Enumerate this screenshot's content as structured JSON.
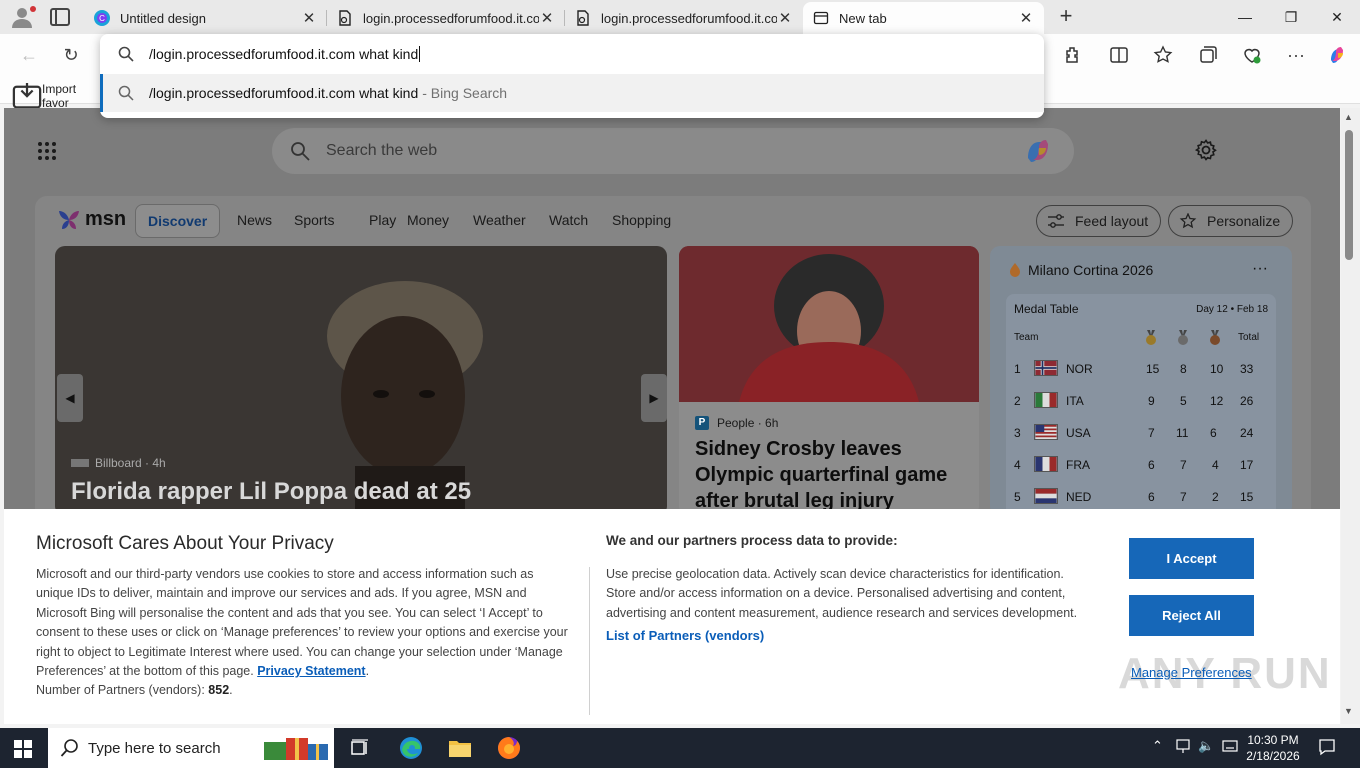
{
  "browser": {
    "tabs": [
      {
        "title": "Untitled design",
        "favicon": "canva-icon"
      },
      {
        "title": "login.processedforumfood.it.com",
        "favicon": "document-icon"
      },
      {
        "title": "login.processedforumfood.it.com",
        "favicon": "document-icon"
      },
      {
        "title": "New tab",
        "favicon": "newtab-icon"
      }
    ],
    "favorites_bar": {
      "import_label": "Import favor"
    }
  },
  "omnibox": {
    "typed": "/login.processedforumfood.it.com what kind",
    "suggestion_query": "/login.processedforumfood.it.com what kind",
    "suggestion_suffix": "- Bing Search"
  },
  "newtab": {
    "search_placeholder": "Search the web",
    "msn_logo": "msn",
    "nav": {
      "active": "Discover",
      "items": [
        "News",
        "Sports",
        "Play",
        "Money",
        "Weather",
        "Watch",
        "Shopping"
      ]
    },
    "feed_layout": "Feed layout",
    "personalize": "Personalize",
    "hero": {
      "source": "Billboard · 4h",
      "title": "Florida rapper Lil Poppa dead at 25"
    },
    "card2": {
      "source": "People · 6h",
      "badge": "P",
      "title": "Sidney Crosby leaves Olympic quarterfinal game after brutal leg injury"
    },
    "medal_widget": {
      "title": "Milano Cortina 2026",
      "table_title": "Medal Table",
      "day": "Day 12 • Feb 18",
      "col_team": "Team",
      "col_total": "Total",
      "rows": [
        {
          "rank": "1",
          "team": "NOR",
          "gold": "15",
          "silver": "8",
          "bronze": "10",
          "total": "33"
        },
        {
          "rank": "2",
          "team": "ITA",
          "gold": "9",
          "silver": "5",
          "bronze": "12",
          "total": "26"
        },
        {
          "rank": "3",
          "team": "USA",
          "gold": "7",
          "silver": "11",
          "bronze": "6",
          "total": "24"
        },
        {
          "rank": "4",
          "team": "FRA",
          "gold": "6",
          "silver": "7",
          "bronze": "4",
          "total": "17"
        },
        {
          "rank": "5",
          "team": "NED",
          "gold": "6",
          "silver": "7",
          "bronze": "2",
          "total": "15"
        }
      ]
    }
  },
  "privacy": {
    "title": "Microsoft Cares About Your Privacy",
    "body": "Microsoft and our third-party vendors use cookies to store and access information such as unique IDs to deliver, maintain and improve our services and ads. If you agree, MSN and Microsoft Bing will personalise the content and ads that you see. You can select ‘I Accept’ to consent to these uses or click on ‘Manage preferences’ to review your options and exercise your right to object to Legitimate Interest where used.  You can change your selection under ‘Manage Preferences’ at the bottom of this page.",
    "privacy_link": "Privacy Statement",
    "partners_count_label": "Number of Partners (vendors):",
    "partners_count": "852",
    "data_heading": "We and our partners process data to provide:",
    "data_body": "Use precise geolocation data. Actively scan device characteristics for identification. Store and/or access information on a device. Personalised advertising and content, advertising and content measurement, audience research and services development.",
    "partners_link": "List of Partners (vendors)",
    "accept": "I Accept",
    "reject": "Reject All",
    "manage": "Manage Preferences"
  },
  "watermark": "ANY RUN",
  "taskbar": {
    "search_placeholder": "Type here to search",
    "time": "10:30 PM",
    "date": "2/18/2026"
  }
}
